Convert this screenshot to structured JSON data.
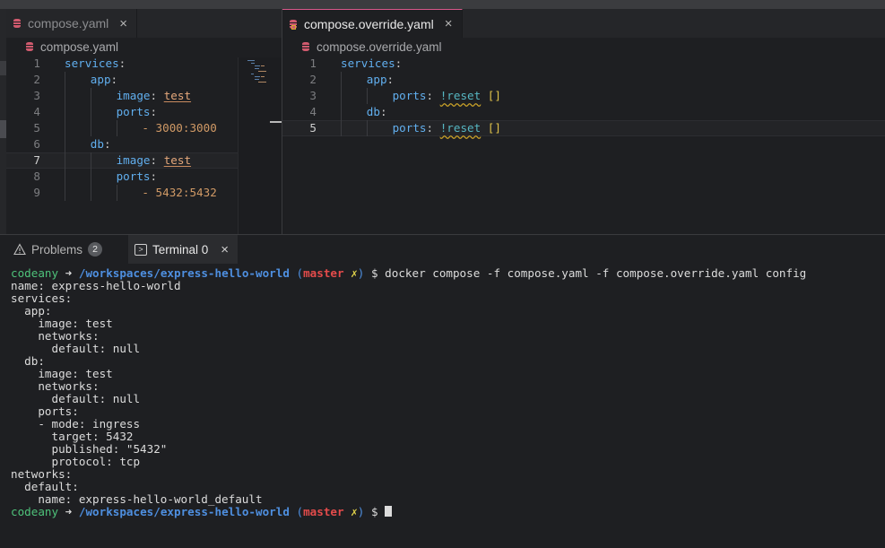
{
  "editor_left": {
    "tab_label": "compose.yaml",
    "breadcrumb": "compose.yaml",
    "lines": [
      {
        "n": "1",
        "indent": 0,
        "key": "services",
        "value": ""
      },
      {
        "n": "2",
        "indent": 1,
        "key": "app",
        "value": ""
      },
      {
        "n": "3",
        "indent": 2,
        "key": "image",
        "value": "test"
      },
      {
        "n": "4",
        "indent": 2,
        "key": "ports",
        "value": ""
      },
      {
        "n": "5",
        "indent": 3,
        "key": "",
        "value": "- 3000:3000"
      },
      {
        "n": "6",
        "indent": 1,
        "key": "db",
        "value": ""
      },
      {
        "n": "7",
        "indent": 2,
        "key": "image",
        "value": "test"
      },
      {
        "n": "8",
        "indent": 2,
        "key": "ports",
        "value": ""
      },
      {
        "n": "9",
        "indent": 3,
        "key": "",
        "value": "- 5432:5432"
      }
    ]
  },
  "editor_right": {
    "tab_label": "compose.override.yaml",
    "breadcrumb": "compose.override.yaml",
    "lines": [
      {
        "n": "1",
        "key": "services",
        "tag": "",
        "brackets": ""
      },
      {
        "n": "2",
        "key": "app",
        "tag": "",
        "brackets": ""
      },
      {
        "n": "3",
        "key": "ports",
        "tag": "!reset",
        "brackets": "[]"
      },
      {
        "n": "4",
        "key": "db",
        "tag": "",
        "brackets": ""
      },
      {
        "n": "5",
        "key": "ports",
        "tag": "!reset",
        "brackets": "[]"
      }
    ]
  },
  "panel": {
    "problems_label": "Problems",
    "problems_count": "2",
    "terminal_label": "Terminal 0"
  },
  "terminal": {
    "prompt": {
      "user": "codeany",
      "arrow": "➜",
      "path": "/workspaces/express-hello-world",
      "branch": "master",
      "dirty": "✗",
      "dollar": "$"
    },
    "command": "docker compose -f compose.yaml -f compose.override.yaml config",
    "output": [
      "name: express-hello-world",
      "services:",
      "  app:",
      "    image: test",
      "    networks:",
      "      default: null",
      "  db:",
      "    image: test",
      "    networks:",
      "      default: null",
      "    ports:",
      "    - mode: ingress",
      "      target: 5432",
      "      published: \"5432\"",
      "      protocol: tcp",
      "networks:",
      "  default:",
      "    name: express-hello-world_default"
    ]
  },
  "colors": {
    "key": "#61afef",
    "string": "#e5a87b",
    "prompt_user": "#4ec27a",
    "prompt_path": "#4e8fe0",
    "branch": "#e44b4b"
  }
}
